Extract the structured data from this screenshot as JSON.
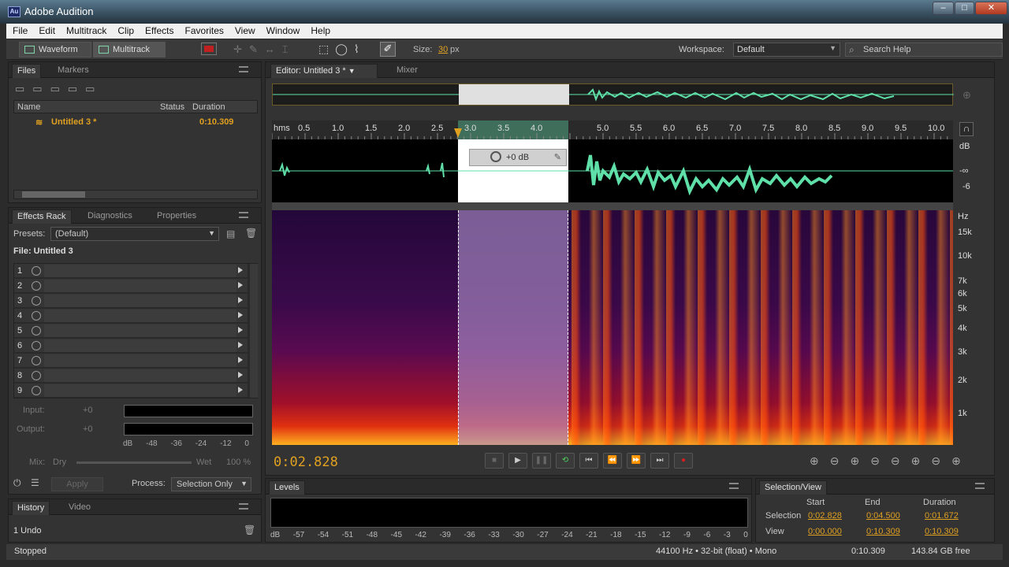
{
  "window": {
    "title": "Adobe Audition",
    "icon": "Au",
    "buttons": {
      "minimize": "–",
      "maximize": "□",
      "close": "✕"
    }
  },
  "menu": [
    "File",
    "Edit",
    "Multitrack",
    "Clip",
    "Effects",
    "Favorites",
    "View",
    "Window",
    "Help"
  ],
  "toolbar": {
    "waveform": "Waveform",
    "multitrack": "Multitrack",
    "size_label": "Size:",
    "size_value": "30",
    "size_unit": "px",
    "workspace_label": "Workspace:",
    "workspace_value": "Default",
    "search_placeholder": "Search Help"
  },
  "files_panel": {
    "tabs": [
      "Files",
      "Markers"
    ],
    "columns": [
      "Name",
      "Status",
      "Duration"
    ],
    "rows": [
      {
        "name": "Untitled 3 *",
        "status": "",
        "duration": "0:10.309"
      }
    ]
  },
  "effects_rack": {
    "tabs": [
      "Effects Rack",
      "Diagnostics",
      "Properties"
    ],
    "presets_label": "Presets:",
    "presets_value": "(Default)",
    "file_label": "File: Untitled 3",
    "slots": [
      "1",
      "2",
      "3",
      "4",
      "5",
      "6",
      "7",
      "8",
      "9"
    ],
    "input_label": "Input:",
    "input_value": "+0",
    "output_label": "Output:",
    "output_value": "+0",
    "meter_scale": [
      "dB",
      "-48",
      "-36",
      "-24",
      "-12",
      "0"
    ],
    "mix_label": "Mix:",
    "dry": "Dry",
    "wet": "Wet",
    "mix_value": "100 %",
    "apply": "Apply",
    "process_label": "Process:",
    "process_value": "Selection Only"
  },
  "history": {
    "tabs": [
      "History",
      "Video"
    ],
    "item": "1 Undo"
  },
  "editor": {
    "tabs": [
      "Editor: Untitled 3 *",
      "Mixer"
    ],
    "ruler": [
      "hms",
      "0.5",
      "1.0",
      "1.5",
      "2.0",
      "2.5",
      "3.0",
      "3.5",
      "4.0",
      "5.0",
      "5.5",
      "6.0",
      "6.5",
      "7.0",
      "7.5",
      "8.0",
      "8.5",
      "9.0",
      "9.5",
      "10.0"
    ],
    "db_scale": [
      "dB",
      "-∞",
      "-6"
    ],
    "hud_db": "+0 dB",
    "hz_scale": [
      "Hz",
      "15k",
      "10k",
      "7k",
      "6k",
      "5k",
      "4k",
      "3k",
      "2k",
      "1k"
    ],
    "time": "0:02.828"
  },
  "levels": {
    "title": "Levels",
    "scale": [
      "dB",
      "-57",
      "-54",
      "-51",
      "-48",
      "-45",
      "-42",
      "-39",
      "-36",
      "-33",
      "-30",
      "-27",
      "-24",
      "-21",
      "-18",
      "-15",
      "-12",
      "-9",
      "-6",
      "-3",
      "0"
    ]
  },
  "selection_view": {
    "title": "Selection/View",
    "columns": [
      "Start",
      "End",
      "Duration"
    ],
    "selection_label": "Selection",
    "view_label": "View",
    "selection": [
      "0:02.828",
      "0:04.500",
      "0:01.672"
    ],
    "view": [
      "0:00.000",
      "0:10.309",
      "0:10.309"
    ]
  },
  "status": {
    "state": "Stopped",
    "format": "44100 Hz • 32-bit (float) • Mono",
    "duration": "0:10.309",
    "free": "143.84 GB free"
  },
  "colors": {
    "accent": "#e0a020",
    "waveform": "#5fe0a8",
    "selection": "#8a6fa0"
  }
}
